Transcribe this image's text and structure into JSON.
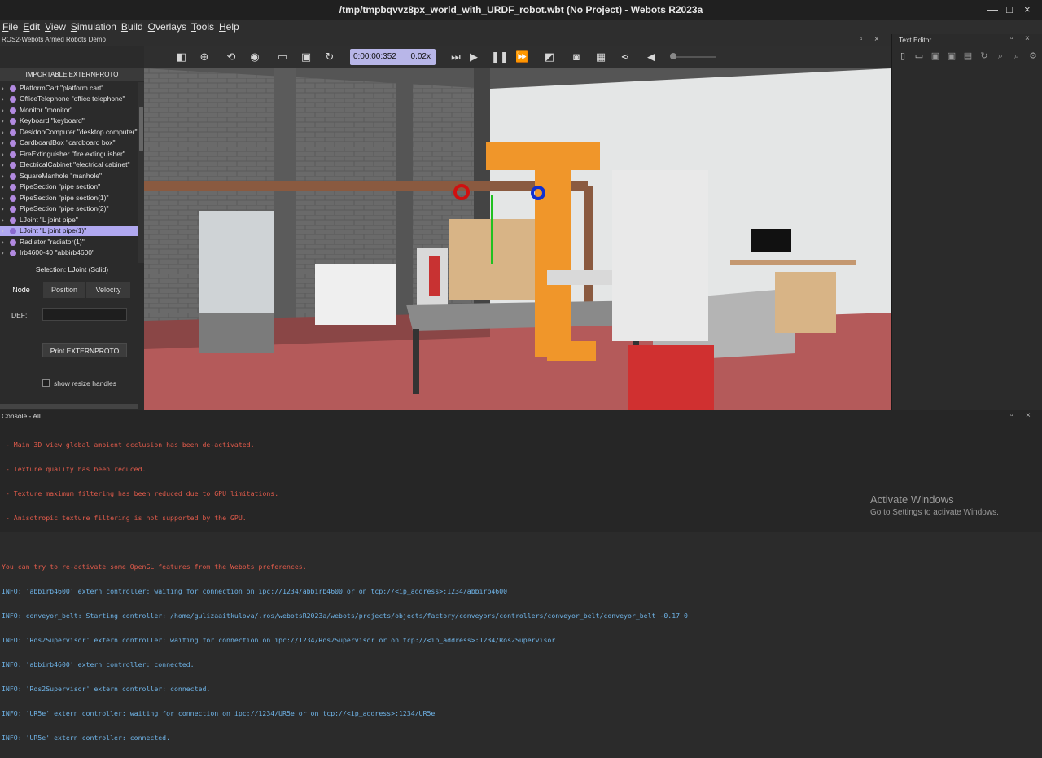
{
  "window": {
    "title": "/tmp/tmpbqvvz8px_world_with_URDF_robot.wbt (No Project) - Webots R2023a",
    "minimize": "—",
    "maximize": "□",
    "close": "×"
  },
  "menu": [
    "File",
    "Edit",
    "View",
    "Simulation",
    "Build",
    "Overlays",
    "Tools",
    "Help"
  ],
  "subbar": {
    "title": "ROS2-Webots Armed Robots Demo",
    "float": "▫",
    "close": "×"
  },
  "toolbar": {
    "time": "0:00:00:352",
    "speed": "0.02x",
    "icons": [
      "show-left-panel-icon",
      "add-node-icon",
      "reset-view-icon",
      "eye-icon",
      "open-world-icon",
      "save-world-icon",
      "reload-world-icon",
      "step-icon",
      "run-icon",
      "pause-icon",
      "fast-icon",
      "cube-icon",
      "screenshot-icon",
      "record-movie-icon",
      "share-icon",
      "volume-icon"
    ]
  },
  "scene": {
    "header": "IMPORTABLE EXTERNPROTO",
    "items": [
      {
        "label": "PlatformCart \"platform cart\""
      },
      {
        "label": "OfficeTelephone \"office telephone\""
      },
      {
        "label": "Monitor \"monitor\""
      },
      {
        "label": "Keyboard \"keyboard\""
      },
      {
        "label": "DesktopComputer \"desktop computer\""
      },
      {
        "label": "CardboardBox \"cardboard box\""
      },
      {
        "label": "FireExtinguisher \"fire extinguisher\""
      },
      {
        "label": "ElectricalCabinet \"electrical cabinet\""
      },
      {
        "label": "SquareManhole \"manhole\""
      },
      {
        "label": "PipeSection \"pipe section\""
      },
      {
        "label": "PipeSection \"pipe section(1)\""
      },
      {
        "label": "PipeSection \"pipe section(2)\""
      },
      {
        "label": "LJoint \"L joint pipe\""
      },
      {
        "label": "LJoint \"L joint pipe(1)\""
      },
      {
        "label": "Radiator \"radiator(1)\""
      },
      {
        "label": "Irb4600-40 \"abbirb4600\""
      }
    ],
    "selected_index": 13
  },
  "selection": "Selection: LJoint (Solid)",
  "tabs": [
    "Node",
    "Position",
    "Velocity"
  ],
  "node": {
    "def_label": "DEF:",
    "def_value": "",
    "print_button": "Print EXTERNPROTO",
    "resize_label": "show resize handles"
  },
  "text_editor": {
    "title": "Text Editor",
    "float": "▫",
    "close": "×"
  },
  "console": {
    "title": "Console - All",
    "lines": [
      {
        "type": "err",
        "text": " - Main 3D view global ambient occlusion has been de-activated."
      },
      {
        "type": "err",
        "text": " - Texture quality has been reduced."
      },
      {
        "type": "err",
        "text": " - Texture maximum filtering has been reduced due to GPU limitations."
      },
      {
        "type": "err",
        "text": " - Anisotropic texture filtering is not supported by the GPU."
      },
      {
        "type": "err",
        "text": ""
      },
      {
        "type": "err",
        "text": "You can try to re-activate some OpenGL features from the Webots preferences."
      },
      {
        "type": "info",
        "text": "INFO: 'abbirb4600' extern controller: waiting for connection on ipc://1234/abbirb4600 or on tcp://<ip_address>:1234/abbirb4600"
      },
      {
        "type": "info",
        "text": "INFO: conveyor_belt: Starting controller: /home/gulizaaitkulova/.ros/webotsR2023a/webots/projects/objects/factory/conveyors/controllers/conveyor_belt/conveyor_belt -0.17 0"
      },
      {
        "type": "info",
        "text": "INFO: 'Ros2Supervisor' extern controller: waiting for connection on ipc://1234/Ros2Supervisor or on tcp://<ip_address>:1234/Ros2Supervisor"
      },
      {
        "type": "info",
        "text": "INFO: 'abbirb4600' extern controller: connected."
      },
      {
        "type": "info",
        "text": "INFO: 'Ros2Supervisor' extern controller: connected."
      },
      {
        "type": "info",
        "text": "INFO: 'UR5e' extern controller: waiting for connection on ipc://1234/UR5e or on tcp://<ip_address>:1234/UR5e"
      },
      {
        "type": "info",
        "text": "INFO: 'UR5e' extern controller: connected."
      }
    ],
    "activate_title": "Activate Windows",
    "activate_sub": "Go to Settings to activate Windows."
  }
}
